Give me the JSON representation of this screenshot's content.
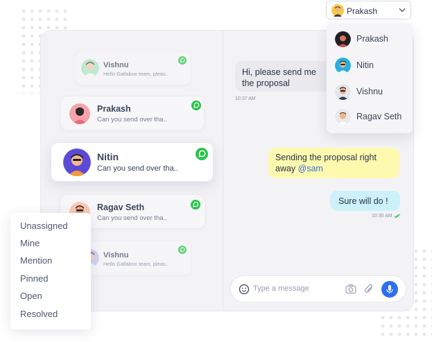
{
  "agent_selector": {
    "selected": "Prakash",
    "options": [
      "Prakash",
      "Nitin",
      "Vishnu",
      "Ragav Seth"
    ]
  },
  "conversations": [
    {
      "name": "Vishnu",
      "preview": "Hello Gallabox team, pleas..",
      "channel_icon": "whatsapp-icon"
    },
    {
      "name": "Prakash",
      "preview": "Can you send over tha..",
      "channel_icon": "whatsapp-icon"
    },
    {
      "name": "Nitin",
      "preview": "Can you send over tha..",
      "channel_icon": "whatsapp-icon"
    },
    {
      "name": "Ragav Seth",
      "preview": "Can you send over tha..",
      "channel_icon": "whatsapp-icon"
    },
    {
      "name": "Vishnu",
      "preview": "Hello Gallabox team, pleas..",
      "channel_icon": "whatsapp-icon"
    }
  ],
  "chat": {
    "messages": [
      {
        "direction": "incoming",
        "text": "Hi, please send me the proposal",
        "time": "10:37 AM"
      },
      {
        "direction": "outgoing",
        "text": "Sending the proposal right away ",
        "mention": "@sam"
      },
      {
        "direction": "outgoing",
        "text": "Sure will do !",
        "time": "10:35 AM",
        "status": "read"
      }
    ],
    "input": {
      "placeholder": "Type a message",
      "icons": [
        "emoji-icon",
        "camera-icon",
        "attachment-icon",
        "microphone-icon"
      ]
    }
  },
  "status_filter": {
    "options": [
      "Unassigned",
      "Mine",
      "Mention",
      "Pinned",
      "Open",
      "Resolved"
    ]
  },
  "colors": {
    "accent_blue": "#2f6ff0",
    "whatsapp_green": "#27c449",
    "outgoing_bubble": "#fdfab0",
    "reply_bubble": "#cdf1f8",
    "mention": "#3b6fd8"
  }
}
